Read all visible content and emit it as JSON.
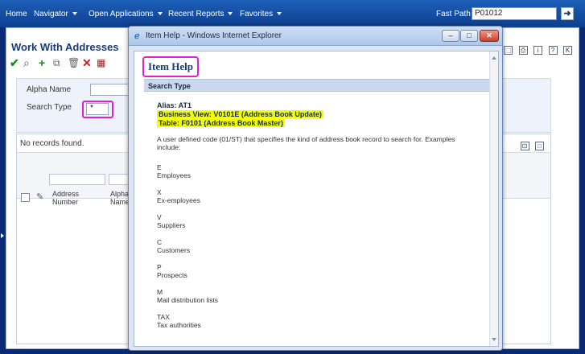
{
  "topbar": {
    "home": "Home",
    "navigator": "Navigator",
    "open_applications": "Open Applications",
    "recent_reports": "Recent Reports",
    "favorites": "Favorites",
    "fast_path_label": "Fast Path",
    "fast_path_value": "P01012",
    "go_button": "➜"
  },
  "main": {
    "title": "Work With Addresses",
    "filters": {
      "alpha_name_label": "Alpha Name",
      "alpha_name_value": "",
      "search_type_label": "Search Type",
      "search_type_value": "*"
    },
    "grid": {
      "status": "No records found.",
      "columns": [
        "Address Number",
        "Alpha Name"
      ],
      "column_lines": [
        [
          "Address",
          "Number"
        ],
        [
          "Alpha",
          "Name"
        ]
      ]
    }
  },
  "popup": {
    "window_title": "Item Help - Windows Internet Explorer",
    "help_title": "Item Help",
    "section": "Search Type",
    "alias": "Alias: AT1",
    "business_view": "Business View: V0101E (Address Book Update)",
    "table": "Table: F0101 (Address Book Master)",
    "description": "A user defined code (01/ST) that specifies the kind of address book record to search for. Examples include:",
    "codes": [
      {
        "code": "E",
        "label": "Employees"
      },
      {
        "code": "X",
        "label": "Ex-employees"
      },
      {
        "code": "V",
        "label": "Suppliers"
      },
      {
        "code": "C",
        "label": "Customers"
      },
      {
        "code": "P",
        "label": "Prospects"
      },
      {
        "code": "M",
        "label": "Mail distribution lists"
      },
      {
        "code": "TAX",
        "label": "Tax authorities"
      }
    ]
  },
  "colors": {
    "highlight_magenta": "#e020d0",
    "highlight_yellow": "#f2ff00",
    "nav_blue": "#0d3f8f"
  }
}
